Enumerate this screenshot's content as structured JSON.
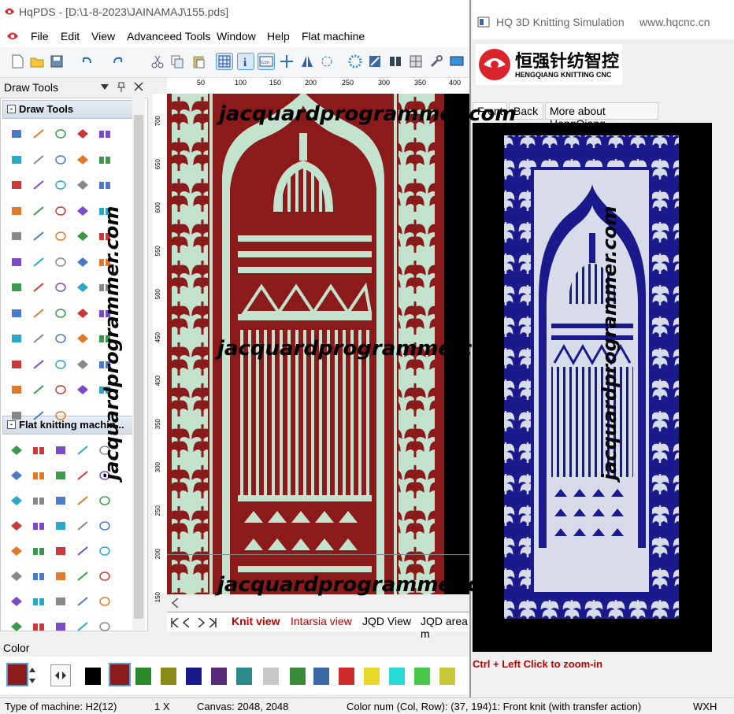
{
  "app": {
    "title": "HqPDS - [D:\\1-8-2023\\JAINAMAJ\\155.pds]"
  },
  "menu": [
    "File",
    "Edit",
    "View",
    "Advanceed Tools",
    "Window",
    "Help",
    "Flat machine"
  ],
  "draw_tools_panel": {
    "title": "Draw Tools",
    "section1": "Draw Tools",
    "section2": "Flat knitting machin..."
  },
  "ruler": {
    "top": [
      "50",
      "100",
      "150",
      "200",
      "250",
      "300",
      "350",
      "400"
    ],
    "left": [
      "700",
      "650",
      "600",
      "550",
      "500",
      "450",
      "400",
      "350",
      "300",
      "250",
      "200",
      "150"
    ]
  },
  "view_tabs": [
    "Knit view",
    "Intarsia view",
    "JQD View",
    "JQD area m"
  ],
  "color_panel": {
    "title": "Color"
  },
  "status": {
    "machine": "Type of machine: H2(12)",
    "zoom": "1 X",
    "canvas": "Canvas: 2048, 2048",
    "color_num": "Color num (Col, Row): (37, 194)1: Front knit (with transfer action)",
    "wxh": "WXH"
  },
  "sim": {
    "title": "HQ 3D Knitting Simulation",
    "url": "www.hqcnc.cn",
    "logo_cn": "恒强针纺智控",
    "logo_en": "HENGQIANG KNITTING CNC",
    "tabs": [
      "Front",
      "Back",
      "More about HengQiang"
    ],
    "hint": "Ctrl + Left Click to zoom-in"
  },
  "watermarks": {
    "h1": "jacquardprogrammer.com",
    "h2": "jacquardprogramme.co",
    "h3": "jacquardprogrammer.co",
    "v1": "jacquardprogrammer.com",
    "v2": "jacquardprogrammer.com"
  },
  "colors": {
    "maroon": "#8b1a1a",
    "mint": "#c3e3cf",
    "navy": "#1a1a8c",
    "pale": "#d8dcea",
    "accent": "#0055aa"
  },
  "icons": [
    "app-logo-icon",
    "new-icon",
    "open-icon",
    "save-icon",
    "undo-icon",
    "redo-icon",
    "cut-icon",
    "copy-icon",
    "paste-icon",
    "grid-icon",
    "info-icon",
    "icon-icon",
    "select-icon",
    "pin-icon",
    "close-icon"
  ]
}
